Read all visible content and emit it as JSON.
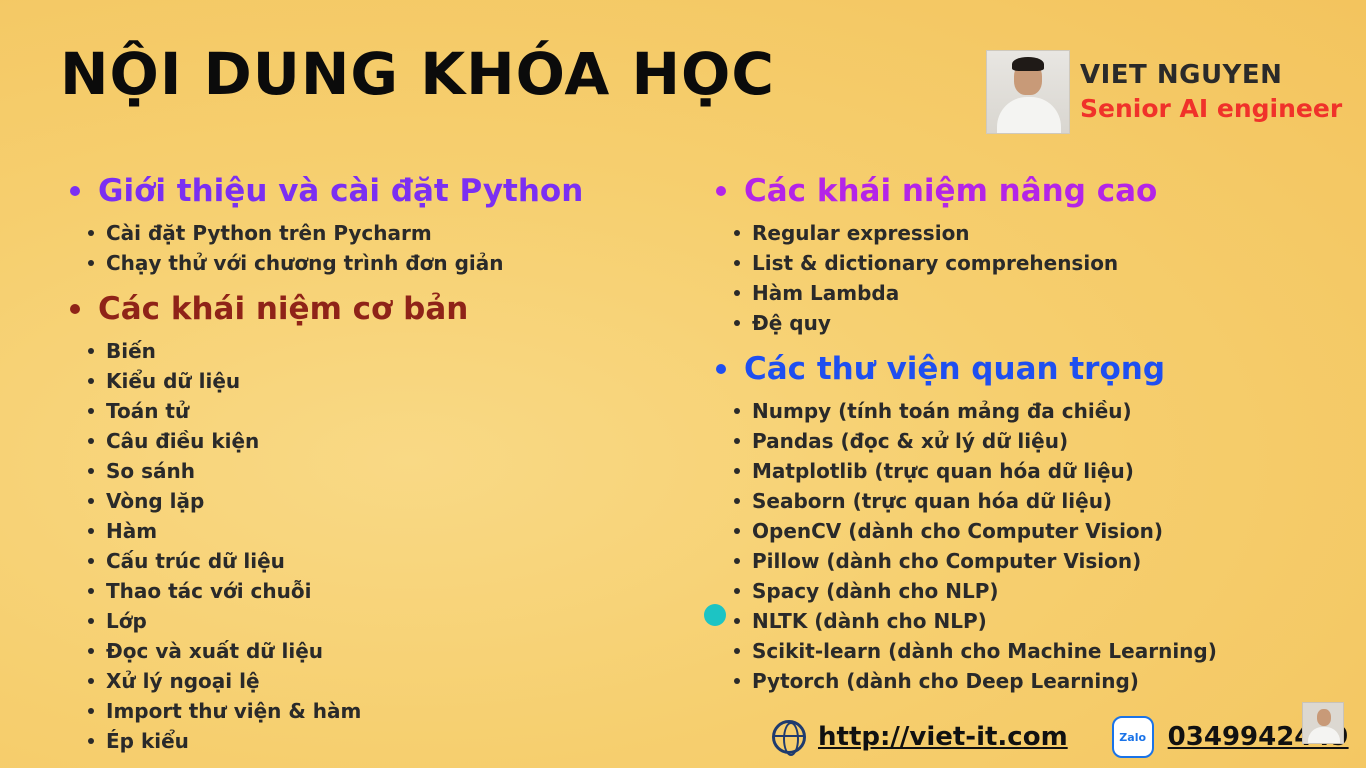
{
  "title": "NỘI DUNG KHÓA HỌC",
  "author": {
    "name": "VIET NGUYEN",
    "role": "Senior AI engineer"
  },
  "colors": {
    "intro": "#7b2ff2",
    "basic": "#8f2318",
    "advanced": "#b424e8",
    "libraries": "#1f4ff0",
    "role": "#f0322a"
  },
  "sections": {
    "intro": {
      "heading": "Giới thiệu và cài đặt Python",
      "items": [
        "Cài đặt Python trên Pycharm",
        "Chạy thử với chương trình đơn giản"
      ]
    },
    "basic": {
      "heading": "Các khái niệm cơ bản",
      "items": [
        "Biến",
        "Kiểu dữ liệu",
        "Toán tử",
        "Câu điều kiện",
        "So sánh",
        "Vòng lặp",
        "Hàm",
        "Cấu trúc dữ liệu",
        "Thao tác với chuỗi",
        "Lớp",
        "Đọc và xuất dữ liệu",
        "Xử lý ngoại lệ",
        "Import thư viện & hàm",
        "Ép kiểu"
      ]
    },
    "advanced": {
      "heading": "Các khái niệm nâng cao",
      "items": [
        "Regular expression",
        "List & dictionary comprehension",
        "Hàm Lambda",
        "Đệ quy"
      ]
    },
    "libraries": {
      "heading": "Các thư viện quan trọng",
      "items": [
        "Numpy (tính toán mảng đa chiều)",
        "Pandas (đọc & xử lý dữ liệu)",
        "Matplotlib (trực quan hóa dữ liệu)",
        "Seaborn (trực quan hóa dữ liệu)",
        "OpenCV (dành cho Computer Vision)",
        "Pillow (dành cho Computer Vision)",
        "Spacy (dành cho NLP)",
        "NLTK (dành cho NLP)",
        "Scikit-learn (dành cho Machine Learning)",
        "Pytorch (dành cho Deep Learning)"
      ]
    }
  },
  "footer": {
    "website": "http://viet-it.com",
    "zalo_label": "Zalo",
    "phone": "0349942449"
  }
}
